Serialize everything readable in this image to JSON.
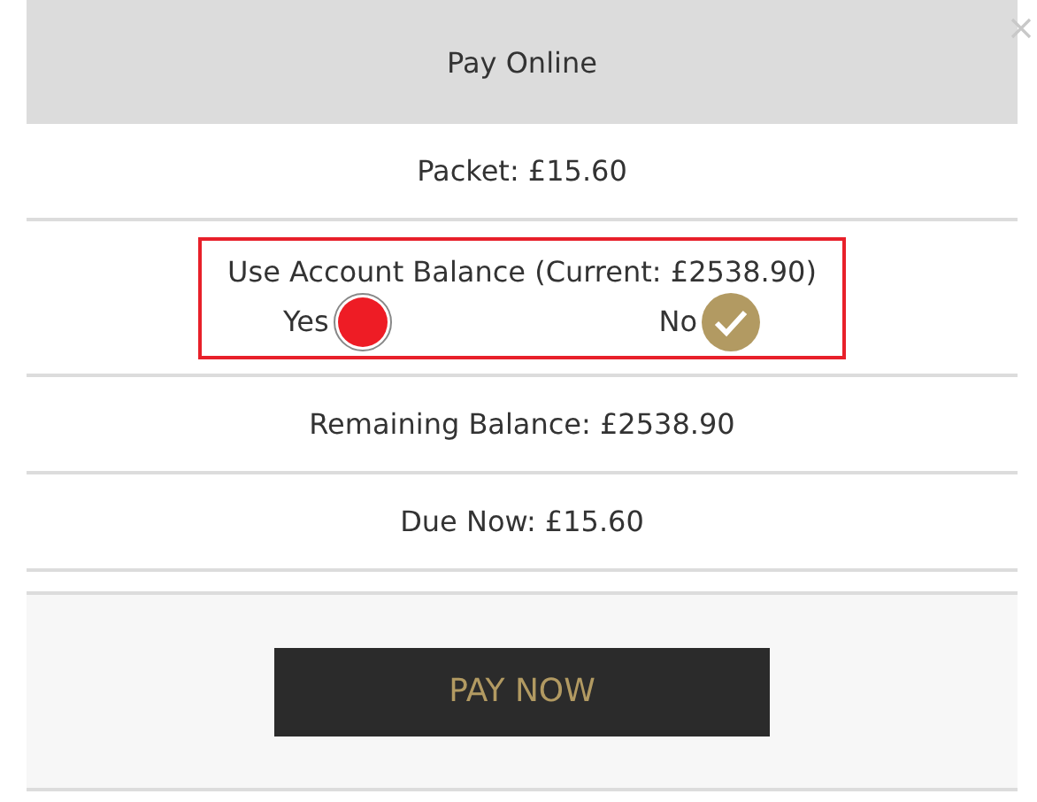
{
  "dialog": {
    "title": "Pay Online"
  },
  "packet": "Packet: £15.60",
  "account_balance": {
    "label": "Use Account Balance (Current: £2538.90)",
    "highlighted": true,
    "options": [
      {
        "label": "Yes",
        "selected": false
      },
      {
        "label": "No",
        "selected": true
      }
    ]
  },
  "remaining": "Remaining Balance: £2538.90",
  "due": "Due Now: £15.60",
  "button": "PAY NOW"
}
